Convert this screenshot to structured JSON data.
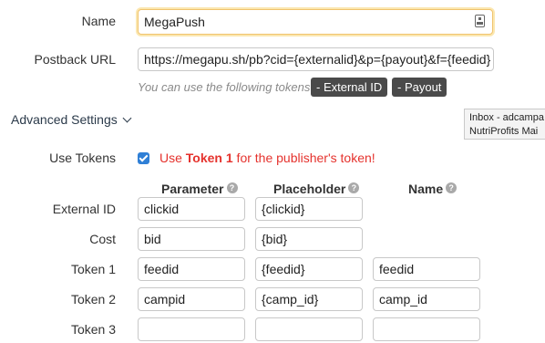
{
  "form": {
    "name_label": "Name",
    "name_value": "MegaPush",
    "postback_label": "Postback URL",
    "postback_value": "https://megapu.sh/pb?cid={externalid}&p={payout}&f={feedid}",
    "tokens_hint": "You can use the following tokens:",
    "token_badges": [
      "- External ID",
      "- Payout"
    ]
  },
  "advanced": {
    "title": "Advanced Settings",
    "use_tokens_label": "Use Tokens",
    "use_tokens_checked": true,
    "warning_prefix": "Use ",
    "warning_bold": "Token 1",
    "warning_suffix": " for the publisher's token!"
  },
  "tooltip": {
    "lines": [
      "Inbox - adcampa",
      "NutriProfits Mai"
    ]
  },
  "params_table": {
    "columns": [
      "Parameter",
      "Placeholder",
      "Name"
    ],
    "rows": [
      {
        "label": "External ID",
        "parameter": "clickid",
        "placeholder": "{clickid}",
        "name": null
      },
      {
        "label": "Cost",
        "parameter": "bid",
        "placeholder": "{bid}",
        "name": null
      },
      {
        "label": "Token 1",
        "parameter": "feedid",
        "placeholder": "{feedid}",
        "name": "feedid"
      },
      {
        "label": "Token 2",
        "parameter": "campid",
        "placeholder": "{camp_id}",
        "name": "camp_id"
      },
      {
        "label": "Token 3",
        "parameter": "",
        "placeholder": "",
        "name": ""
      }
    ]
  },
  "colors": {
    "warning": "#e5322d",
    "checkbox": "#2f7fd6",
    "badge_bg": "#4a4a4a",
    "focus_border": "#f0c36d"
  }
}
